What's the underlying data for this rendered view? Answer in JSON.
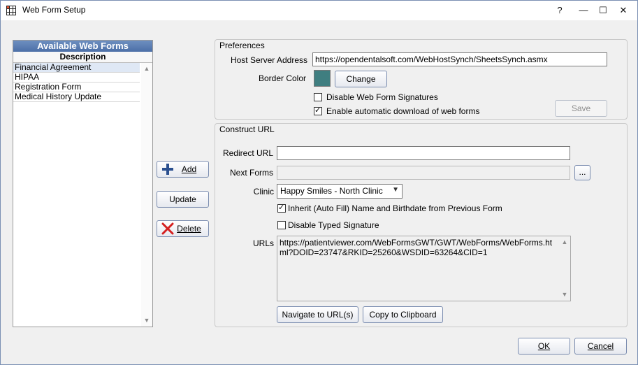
{
  "window": {
    "title": "Web Form Setup",
    "controls": {
      "help": "?",
      "minimize": "—",
      "maximize": "☐",
      "close": "✕"
    }
  },
  "forms_list": {
    "title": "Available Web Forms",
    "column_header": "Description",
    "items": [
      "Financial Agreement",
      "HIPAA",
      "Registration Form",
      "Medical History Update"
    ],
    "selected_index": 0
  },
  "actions": {
    "add_label": "Add",
    "update_label": "Update",
    "delete_label": "Delete"
  },
  "preferences": {
    "group_title": "Preferences",
    "host_server_label": "Host Server Address",
    "host_server_value": "https://opendentalsoft.com/WebHostSynch/SheetsSynch.asmx",
    "border_color_label": "Border Color",
    "border_color_value": "#3f7e80",
    "change_label": "Change",
    "disable_signatures_label": "Disable Web Form Signatures",
    "disable_signatures_checked": false,
    "auto_download_label": "Enable automatic download of web forms",
    "auto_download_checked": true,
    "save_label": "Save"
  },
  "construct_url": {
    "group_title": "Construct URL",
    "redirect_label": "Redirect URL",
    "redirect_value": "",
    "next_forms_label": "Next Forms",
    "next_forms_value": "",
    "browse_label": "...",
    "clinic_label": "Clinic",
    "clinic_value": "Happy Smiles - North Clinic",
    "inherit_label": "Inherit (Auto Fill) Name and Birthdate from Previous Form",
    "inherit_checked": true,
    "disable_typed_label": "Disable Typed Signature",
    "disable_typed_checked": false,
    "urls_label": "URLs",
    "urls_value": "https://patientviewer.com/WebFormsGWT/GWT/WebForms/WebForms.html?DOID=23747&RKID=25260&WSDID=63264&CID=1",
    "navigate_label": "Navigate to URL(s)",
    "copy_label": "Copy to Clipboard"
  },
  "footer": {
    "ok_label": "OK",
    "cancel_label": "Cancel"
  }
}
